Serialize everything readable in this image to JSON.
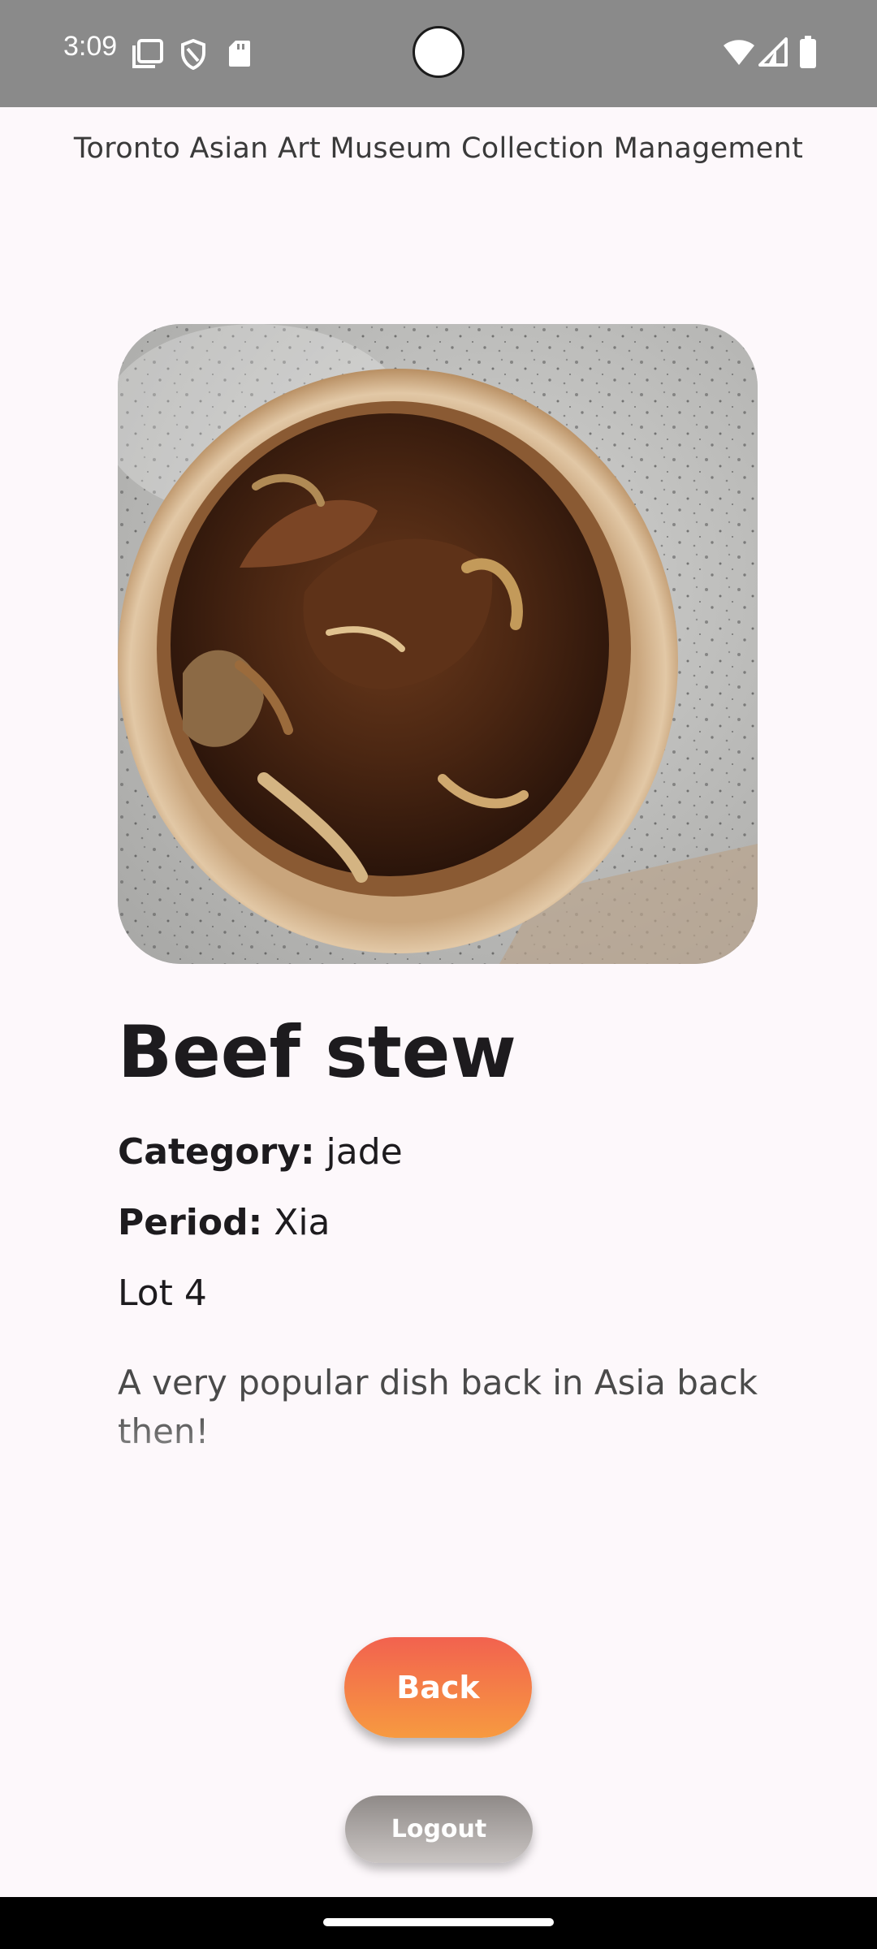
{
  "status_bar": {
    "time": "3:09",
    "left_icons": [
      "screen-record-icon",
      "vpn-shield-icon",
      "sd-card-icon"
    ],
    "right_icons": [
      "wifi-icon",
      "cell-signal-icon",
      "battery-icon"
    ]
  },
  "header": {
    "title": "Toronto Asian Art Museum Collection Management"
  },
  "artifact": {
    "image_icon": "artifact-photo",
    "name": "Beef stew",
    "category_label": "Category:",
    "category_value": " jade",
    "period_label": "Period:",
    "period_value": " Xia",
    "lot": "Lot 4",
    "description": "A very popular dish back in Asia back then!"
  },
  "buttons": {
    "back_label": "Back",
    "logout_label": "Logout"
  },
  "colors": {
    "background": "#fdf8fb",
    "status_bar": "#8a8a8a",
    "back_gradient_start": "#f2624f",
    "back_gradient_end": "#f79a40",
    "logout_gradient_start": "#8f8a88",
    "logout_gradient_end": "#c9c4c2",
    "text_primary": "#1d1b1e"
  }
}
